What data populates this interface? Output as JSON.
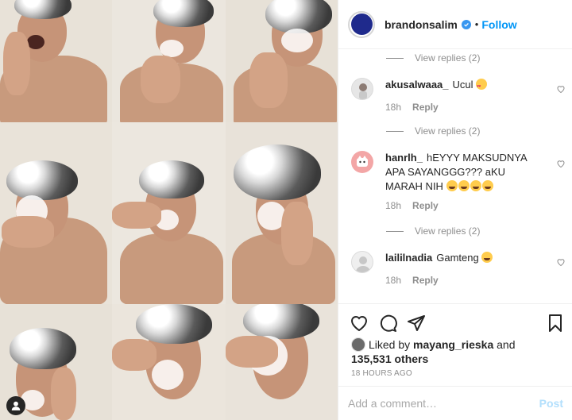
{
  "post": {
    "username": "brandonsalim",
    "separator": "•",
    "follow_label": "Follow"
  },
  "comments": {
    "view_replies_top": "View replies (2)",
    "items": [
      {
        "username": "akusalwaaa_",
        "text": "Ucul",
        "emoji": "heart-eyes",
        "time": "18h",
        "reply_label": "Reply",
        "view_replies": "View replies (2)"
      },
      {
        "username": "hanrlh_",
        "text": "hEYYY MAKSUDNYA APA SAYANGGG??? aKU MARAH NIH",
        "emoji": "crying-face x4",
        "time": "18h",
        "reply_label": "Reply",
        "view_replies": "View replies (2)"
      },
      {
        "username": "laililnadia",
        "text": "Gamteng",
        "emoji": "loudly-crying-face",
        "time": "18h",
        "reply_label": "Reply"
      }
    ]
  },
  "likes": {
    "prefix": "Liked by",
    "user": "mayang_rieska",
    "connector": "and",
    "count": "135,531 others"
  },
  "timestamp": "18 HOURS AGO",
  "add_comment": {
    "placeholder": "Add a comment…",
    "post_label": "Post"
  },
  "colors": {
    "link_blue": "#0095f6",
    "verified_blue": "#3897f0",
    "muted_gray": "#8e8e8e",
    "post_disabled": "#b2dffc"
  }
}
